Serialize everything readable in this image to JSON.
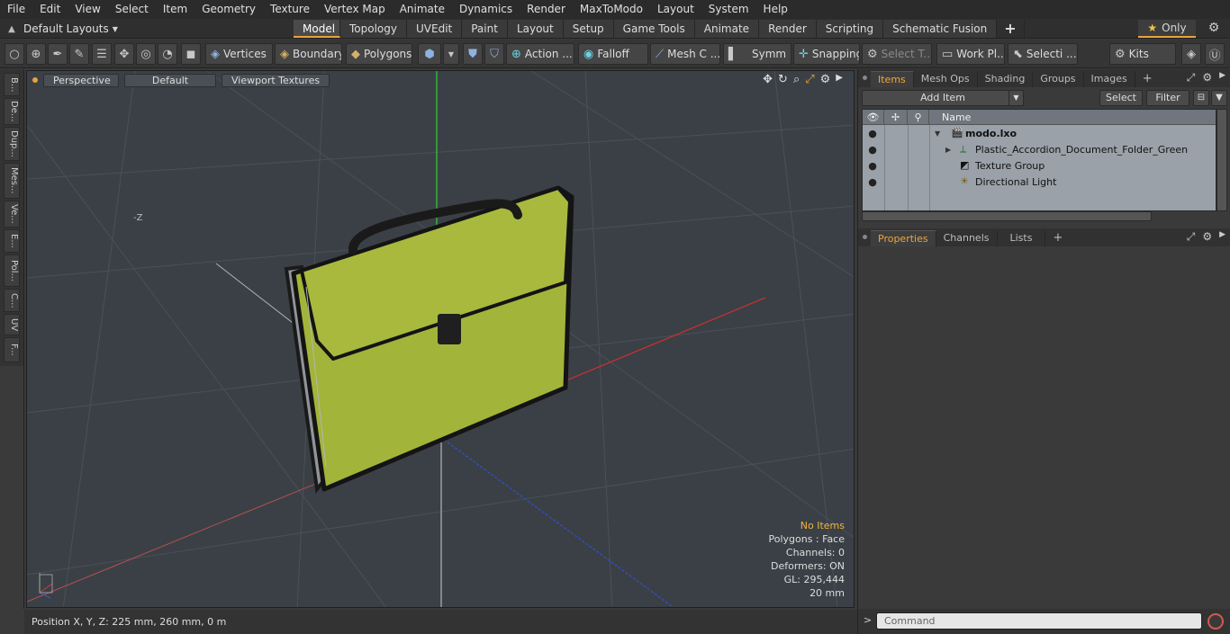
{
  "menu": [
    "File",
    "Edit",
    "View",
    "Select",
    "Item",
    "Geometry",
    "Texture",
    "Vertex Map",
    "Animate",
    "Dynamics",
    "Render",
    "MaxToModo",
    "Layout",
    "System",
    "Help"
  ],
  "layout_selector": "Default Layouts",
  "layout_tabs": [
    "Model",
    "Topology",
    "UVEdit",
    "Paint",
    "Layout",
    "Setup",
    "Game Tools",
    "Animate",
    "Render",
    "Scripting",
    "Schematic Fusion"
  ],
  "active_layout_tab": "Model",
  "only_label": "Only",
  "toolbar": {
    "vertices": "Vertices",
    "boundary": "Boundary",
    "polygons": "Polygons",
    "action": "Action ...",
    "falloff": "Falloff",
    "mesh": "Mesh C ...",
    "symm": "Symm ...",
    "snapping": "Snapping",
    "select_t": "Select T...",
    "work_pl": "Work Pl...",
    "selecti": "Selecti ...",
    "kits": "Kits"
  },
  "left_tabs": [
    "B...",
    "De...",
    "Dup...",
    "Mes...",
    "Ve...",
    "E...",
    "Pol...",
    "C...",
    "UV",
    "F..."
  ],
  "viewport": {
    "buttons": [
      "Perspective",
      "Default",
      "Viewport Textures"
    ],
    "axis_label": "-Z",
    "info": {
      "no_items": "No Items",
      "polygons": "Polygons : Face",
      "channels": "Channels: 0",
      "deformers": "Deformers: ON",
      "gl": "GL: 295,444",
      "scale": "20 mm"
    }
  },
  "status": {
    "position": "Position X, Y, Z:  225 mm, 260 mm, 0 m"
  },
  "items_panel": {
    "tabs": [
      "Items",
      "Mesh Ops",
      "Shading",
      "Groups",
      "Images"
    ],
    "active_tab": "Items",
    "add_item": "Add Item",
    "select": "Select",
    "filter": "Filter",
    "name_col": "Name",
    "rows": [
      {
        "label": "modo.lxo",
        "icon": "scene-icon"
      },
      {
        "label": "Plastic_Accordion_Document_Folder_Green",
        "icon": "mesh-icon"
      },
      {
        "label": "Texture Group",
        "icon": "texture-group-icon"
      },
      {
        "label": "Directional Light",
        "icon": "light-icon"
      }
    ]
  },
  "props_panel": {
    "tabs": [
      "Properties",
      "Channels",
      "Lists"
    ],
    "active_tab": "Properties"
  },
  "command": {
    "placeholder": "Command"
  },
  "colors": {
    "accent": "#e8a33d",
    "viewport_bg": "#3b4046",
    "folder_green": "#a3b43a",
    "axis_x": "#d23a3a",
    "axis_y": "#3ad23a",
    "axis_z": "#3a5ad2"
  }
}
